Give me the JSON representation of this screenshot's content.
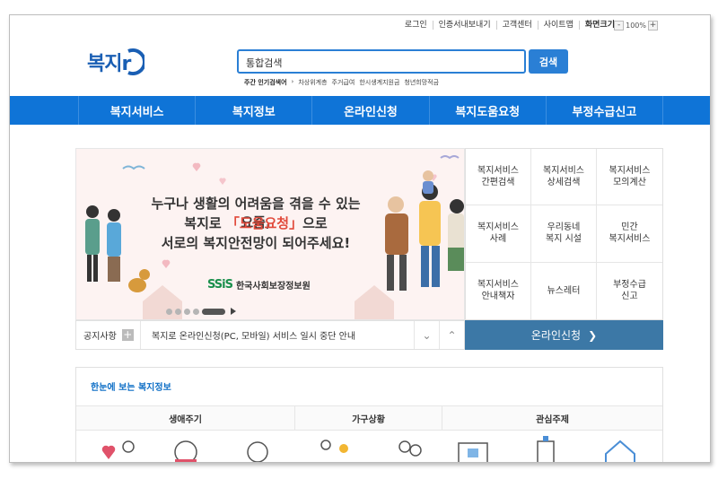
{
  "util": {
    "login": "로그인",
    "cert_docs": "인증서내보내기",
    "customer_center": "고객센터",
    "sitemap": "사이트맵",
    "screen_size": "화면크기",
    "zoom_minus": "-",
    "zoom_value": "100%",
    "zoom_plus": "+"
  },
  "logo": {
    "text": "복지r"
  },
  "search": {
    "placeholder": "통합검색",
    "button": "검색",
    "popular_label": "주간 인기검색어",
    "popular_items": [
      "차상위계층",
      "주거급여",
      "한시생계지원금",
      "청년희망적금"
    ]
  },
  "nav": [
    "복지서비스",
    "복지정보",
    "온라인신청",
    "복지도움요청",
    "부정수급신고"
  ],
  "banner": {
    "line1": "누구나 생활의 어려움을 겪을 수 있는 요즘,",
    "line2_pre": "복지로 ",
    "line2_highlight": "「도움요청」",
    "line2_post": "으로",
    "line3": "서로의 복지안전망이 되어주세요!",
    "org_mark": "SSiS",
    "org_name": "한국사회보장정보원"
  },
  "quick_menu": [
    "복지서비스\n간편검색",
    "복지서비스\n상세검색",
    "복지서비스\n모의계산",
    "복지서비스\n사례",
    "우리동네\n복지 시설",
    "민간\n복지서비스",
    "복지서비스\n안내책자",
    "뉴스레터",
    "부정수급\n신고"
  ],
  "notice": {
    "label": "공지사항",
    "plus": "+",
    "text": "복지로 온라인신청(PC, 모바일) 서비스 일시 중단 안내"
  },
  "online_apply": {
    "label": "온라인신청"
  },
  "info": {
    "title": "한눈에 보는 복지정보",
    "headers": [
      "생애주기",
      "가구상황",
      "관심주제"
    ]
  },
  "colors": {
    "brand_blue": "#0f74d7",
    "online_button": "#3c78a6",
    "highlight_red": "#e14a3b"
  }
}
